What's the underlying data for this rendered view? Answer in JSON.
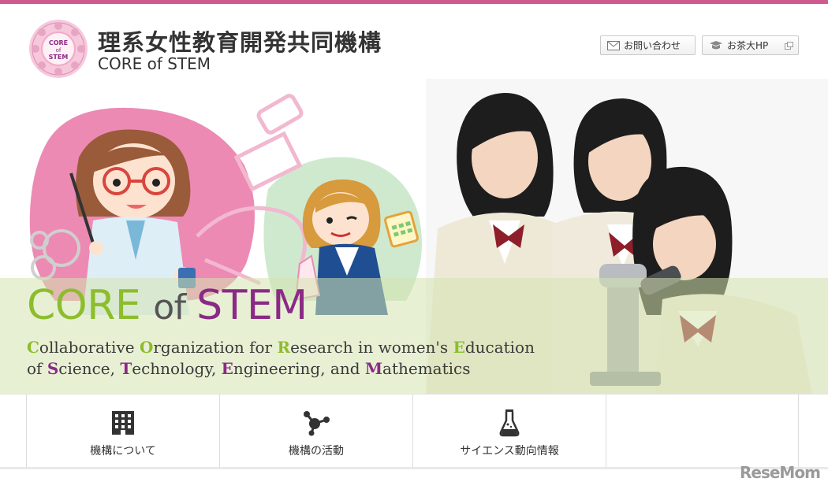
{
  "header": {
    "title_jp": "理系女性教育開発共同機構",
    "title_en": "CORE of STEM",
    "logo_text": "CORE of STEM",
    "contact_label": "お問い合わせ",
    "hp_label": "お茶大HP"
  },
  "hero": {
    "title_part1": "CORE ",
    "title_part2": "of ",
    "title_part3": "STEM",
    "subtitle_line1": [
      {
        "cap": "C",
        "rest": "ollaborative "
      },
      {
        "cap": "O",
        "rest": "rganization for "
      },
      {
        "cap": "R",
        "rest": "esearch in women's "
      },
      {
        "cap": "E",
        "rest": "ducation"
      }
    ],
    "subtitle_line2": [
      {
        "pre": "of ",
        "cap": "S",
        "rest": "cience, "
      },
      {
        "pre": "",
        "cap": "T",
        "rest": "echnology, "
      },
      {
        "pre": "",
        "cap": "E",
        "rest": "ngineering, and "
      },
      {
        "pre": "",
        "cap": "M",
        "rest": "athematics"
      }
    ]
  },
  "nav": {
    "items": [
      {
        "label": "機構について",
        "icon": "building-icon"
      },
      {
        "label": "機構の活動",
        "icon": "molecule-icon"
      },
      {
        "label": "サイエンス動向情報",
        "icon": "flask-icon"
      },
      {
        "label": "",
        "icon": ""
      }
    ]
  },
  "watermark": {
    "text": "ReseMom"
  },
  "colors": {
    "accent_pink": "#cf5b8e",
    "accent_green": "#8cbd2c",
    "accent_purple": "#8a2a86"
  }
}
